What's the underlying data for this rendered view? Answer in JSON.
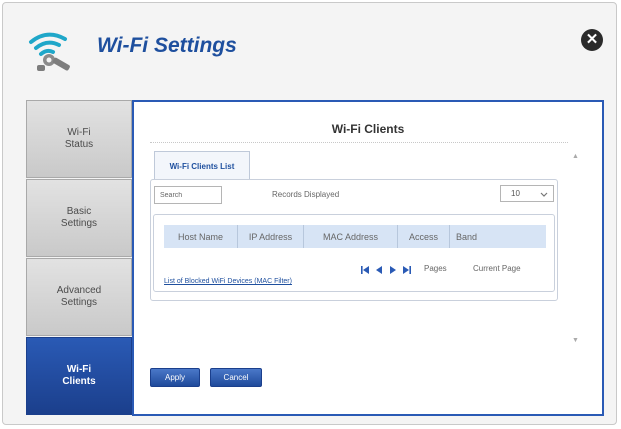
{
  "window": {
    "title": "Wi-Fi Settings"
  },
  "sidebar": {
    "items": [
      {
        "label": "Wi-Fi\nStatus",
        "active": false
      },
      {
        "label": "Basic\nSettings",
        "active": false
      },
      {
        "label": "Advanced\nSettings",
        "active": false
      },
      {
        "label": "Wi-Fi\nClients",
        "active": true
      }
    ]
  },
  "main": {
    "heading": "Wi-Fi Clients",
    "tab_label": "Wi-Fi Clients List",
    "search_placeholder": "Search",
    "records_label": "Records Displayed",
    "per_page_value": "10",
    "columns": [
      "Host Name",
      "IP Address",
      "MAC Address",
      "Access",
      "Band"
    ],
    "pages_label": "Pages",
    "current_page_label": "Current Page",
    "blocked_link": "List of Blocked WiFi Devices (MAC Filter)"
  },
  "buttons": {
    "apply": "Apply",
    "cancel": "Cancel"
  },
  "colors": {
    "accent": "#1e4f9e",
    "active_tab": "#2a5ab5",
    "table_header": "#d7e4f5"
  }
}
